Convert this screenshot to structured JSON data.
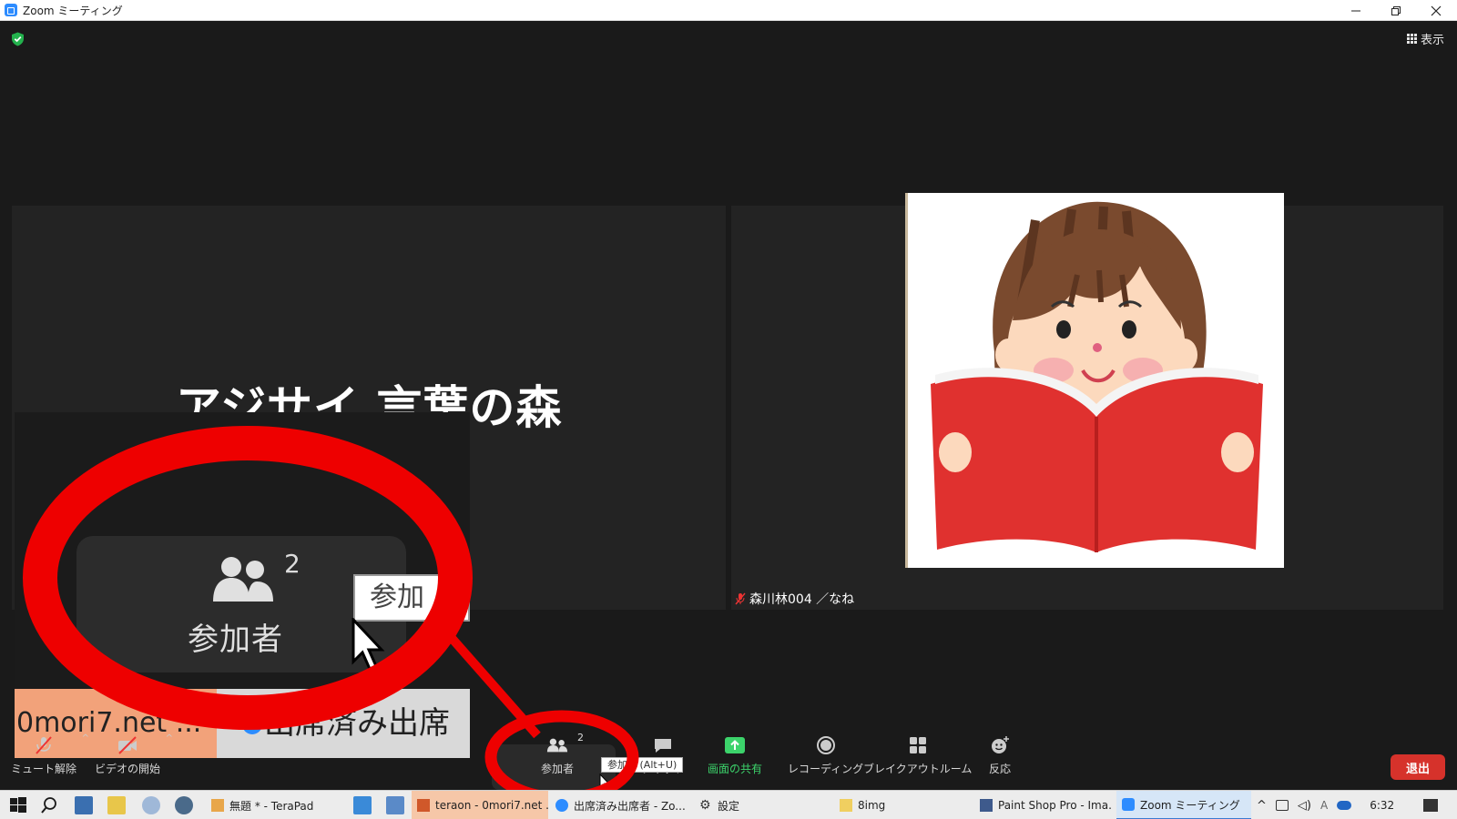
{
  "window": {
    "title": "Zoom ミーティング"
  },
  "top_right": {
    "view_label": "表示"
  },
  "tiles": [
    {
      "display_name": "アジサイ 言葉の森"
    },
    {
      "name_label": "森川林004 ／なね"
    }
  ],
  "inset": {
    "count": "2",
    "label": "参加者",
    "tooltip": "参加",
    "strip_a": "0mori7.net ...",
    "strip_b": "出席済み出席"
  },
  "toolbar": {
    "mute": "ミュート解除",
    "video": "ビデオの開始",
    "participants_count": "2",
    "participants": "参加者",
    "chat": "チャット",
    "share": "画面の共有",
    "record": "レコーディング",
    "breakout": "ブレイクアウトルーム",
    "reactions": "反応",
    "tooltip_left": "参加",
    "tooltip_shortcut": "(Alt+U)",
    "leave": "退出"
  },
  "taskbar": {
    "apps": [
      "無題 * - TeraPad",
      "teraon - 0mori7.net ...",
      "出席済み出席者 - Zo...",
      "設定",
      "8img",
      "Paint Shop Pro - Ima...",
      "Zoom ミーティング"
    ],
    "clock": "6:32",
    "ime": "A"
  },
  "colors": {
    "background": "#1a1a1a",
    "tile": "#232323",
    "accent_green": "#3cd36b",
    "leave_red": "#d6322b",
    "annotation_red": "#ee0000",
    "zoom_blue": "#2d8cff"
  },
  "icons": [
    "shield-icon",
    "grid-icon",
    "mic-off-icon",
    "video-off-icon",
    "participants-icon",
    "chat-icon",
    "share-icon",
    "record-icon",
    "breakout-icon",
    "reaction-icon",
    "cursor-icon",
    "windows-start-icon",
    "search-icon"
  ]
}
